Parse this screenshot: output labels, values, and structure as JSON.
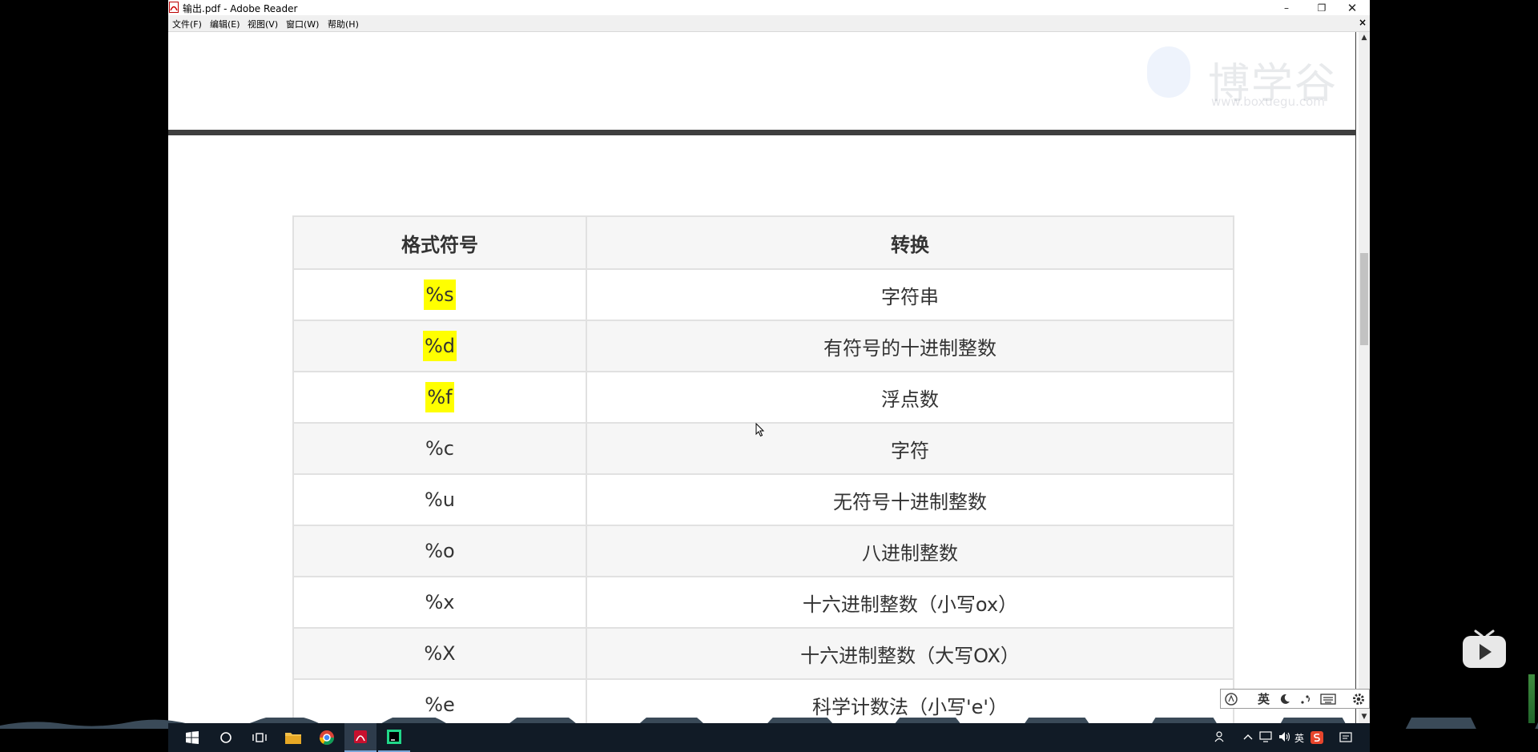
{
  "window": {
    "title": "输出.pdf - Adobe Reader",
    "minimize": "–",
    "restore": "❐",
    "close": "✕"
  },
  "menu": {
    "items": [
      "文件(F)",
      "编辑(E)",
      "视图(V)",
      "窗口(W)",
      "帮助(H)"
    ],
    "close_doc": "×"
  },
  "watermark": {
    "text": "博学谷",
    "url": "www.boxuegu.com"
  },
  "table": {
    "headers": [
      "格式符号",
      "转换"
    ],
    "rows": [
      {
        "symbol": "%s",
        "meaning": "字符串",
        "highlighted": true
      },
      {
        "symbol": "%d",
        "meaning": "有符号的十进制整数",
        "highlighted": true
      },
      {
        "symbol": "%f",
        "meaning": "浮点数",
        "highlighted": true
      },
      {
        "symbol": "%c",
        "meaning": "字符",
        "highlighted": false
      },
      {
        "symbol": "%u",
        "meaning": "无符号十进制整数",
        "highlighted": false
      },
      {
        "symbol": "%o",
        "meaning": "八进制整数",
        "highlighted": false
      },
      {
        "symbol": "%x",
        "meaning": "十六进制整数（小写ox）",
        "highlighted": false
      },
      {
        "symbol": "%X",
        "meaning": "十六进制整数（大写OX）",
        "highlighted": false
      },
      {
        "symbol": "%e",
        "meaning": "科学计数法（小写'e'）",
        "highlighted": false
      }
    ],
    "highlight_color": "#ffff00"
  },
  "scrollbar": {
    "up": "▲",
    "down": "▼",
    "position_fraction": 0.3
  },
  "ime": {
    "mode_label": "英",
    "icons": [
      "ime-logo-icon",
      "moon-icon",
      "punctuation-icon",
      "keyboard-icon",
      "settings-icon"
    ]
  },
  "taskbar": {
    "apps": [
      "windows-start-icon",
      "search-circle-icon",
      "task-view-icon",
      "file-explorer-icon",
      "chrome-icon",
      "adobe-reader-icon",
      "pycharm-icon"
    ],
    "tray_lang": "英"
  },
  "colors": {
    "taskbar": "#111b26",
    "page_separator": "#3f3f3f"
  }
}
